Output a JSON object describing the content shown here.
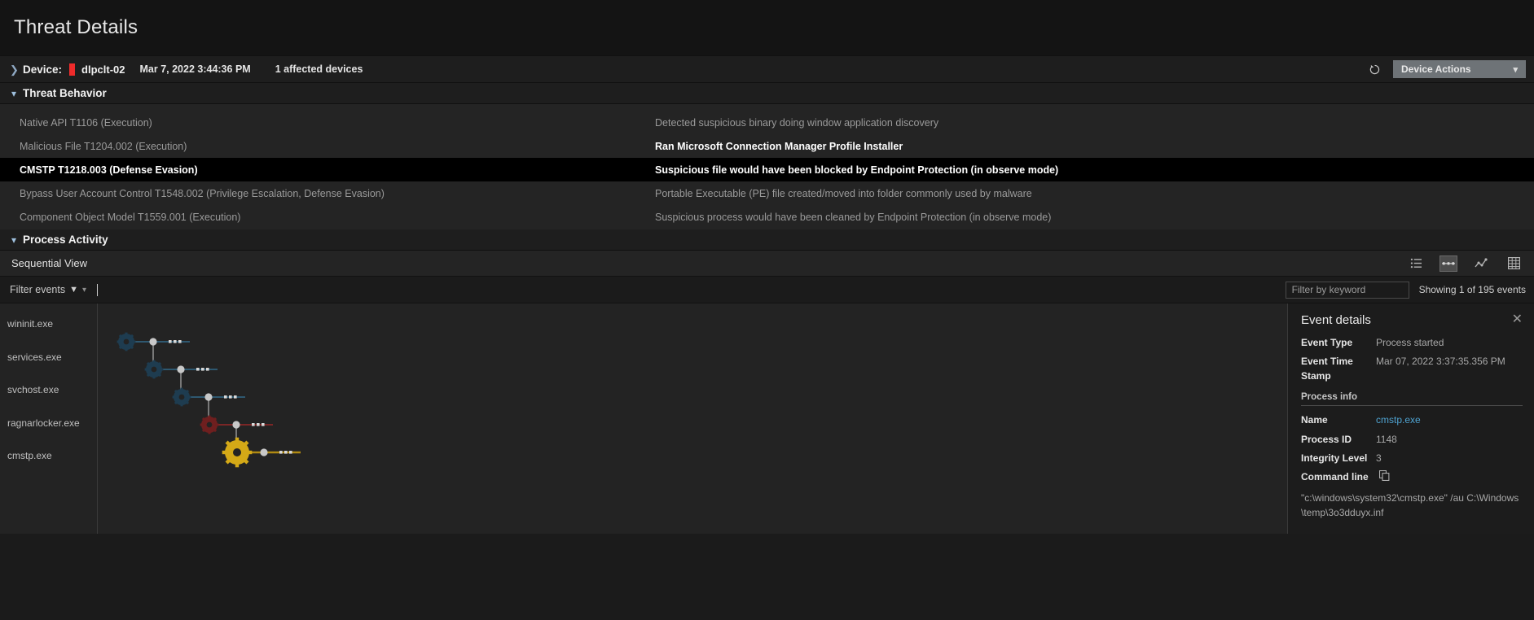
{
  "page": {
    "title": "Threat Details"
  },
  "device_bar": {
    "expand_icon": "chevron-right-icon",
    "device_label": "Device:",
    "severity_color": "#ef2b2b",
    "device_name": "dlpclt-02",
    "timestamp": "Mar 7, 2022 3:44:36 PM",
    "affected_devices": "1 affected devices",
    "refresh_icon": "refresh-icon",
    "device_actions_label": "Device Actions",
    "device_actions_caret": "chevron-down-icon"
  },
  "threat_behavior": {
    "section_title": "Threat Behavior",
    "collapse_icon": "chevron-down-icon",
    "rows": [
      {
        "technique": "Native API T1106 (Execution)",
        "description": "Detected suspicious binary doing window application discovery",
        "selected": false,
        "highlight": false
      },
      {
        "technique": "Malicious File T1204.002 (Execution)",
        "description": "Ran Microsoft Connection Manager Profile Installer",
        "selected": false,
        "highlight": true
      },
      {
        "technique": "CMSTP T1218.003 (Defense Evasion)",
        "description": "Suspicious file would have been blocked by Endpoint Protection (in observe mode)",
        "selected": true,
        "highlight": false
      },
      {
        "technique": "Bypass User Account Control T1548.002 (Privilege Escalation, Defense Evasion)",
        "description": "Portable Executable (PE) file created/moved into folder commonly used by malware",
        "selected": false,
        "highlight": false
      },
      {
        "technique": "Component Object Model T1559.001 (Execution)",
        "description": "Suspicious process would have been cleaned by Endpoint Protection (in observe mode)",
        "selected": false,
        "highlight": false
      }
    ]
  },
  "process_activity": {
    "section_title": "Process Activity",
    "collapse_icon": "chevron-down-icon",
    "view_name": "Sequential View",
    "view_modes": [
      {
        "name": "list-view-icon",
        "active": false
      },
      {
        "name": "sequential-view-icon",
        "active": true
      },
      {
        "name": "graph-view-icon",
        "active": false
      },
      {
        "name": "table-view-icon",
        "active": false
      }
    ],
    "filter": {
      "filter_events_label": "Filter events",
      "funnel_icon": "funnel-icon",
      "caret_icon": "chevron-down-icon",
      "keyword_placeholder": "Filter by keyword",
      "keyword_value": "",
      "showing_text": "Showing 1 of 195 events"
    },
    "process_rail": [
      "wininit.exe",
      "services.exe",
      "svchost.exe",
      "ragnarlocker.exe",
      "cmstp.exe"
    ],
    "graph_nodes": [
      {
        "process": "wininit.exe",
        "gear_color": "#1e3c50",
        "link_color": "#2e5870",
        "selected": false
      },
      {
        "process": "services.exe",
        "gear_color": "#1e3c50",
        "link_color": "#2e5870",
        "selected": false
      },
      {
        "process": "svchost.exe",
        "gear_color": "#1e3c50",
        "link_color": "#2e5870",
        "selected": false
      },
      {
        "process": "ragnarlocker.exe",
        "gear_color": "#6e1f1f",
        "link_color": "#7a2626",
        "selected": false
      },
      {
        "process": "cmstp.exe",
        "gear_color": "#d4a917",
        "link_color": "#b08a12",
        "selected": true
      }
    ]
  },
  "event_details": {
    "title": "Event details",
    "close_icon": "close-icon",
    "fields": [
      {
        "key": "Event Type",
        "value": "Process started",
        "link": false
      },
      {
        "key": "Event Time Stamp",
        "value": "Mar 07, 2022 3:37:35.356 PM",
        "link": false
      }
    ],
    "process_info_label": "Process info",
    "process_fields": [
      {
        "key": "Name",
        "value": "cmstp.exe",
        "link": true
      },
      {
        "key": "Process ID",
        "value": "1148",
        "link": false
      },
      {
        "key": "Integrity Level",
        "value": "3",
        "link": false
      }
    ],
    "command_line_label": "Command line",
    "copy_icon": "copy-icon",
    "command_line_value": "\"c:\\windows\\system32\\cmstp.exe\" /au C:\\Windows\\temp\\3o3dduyx.inf"
  }
}
